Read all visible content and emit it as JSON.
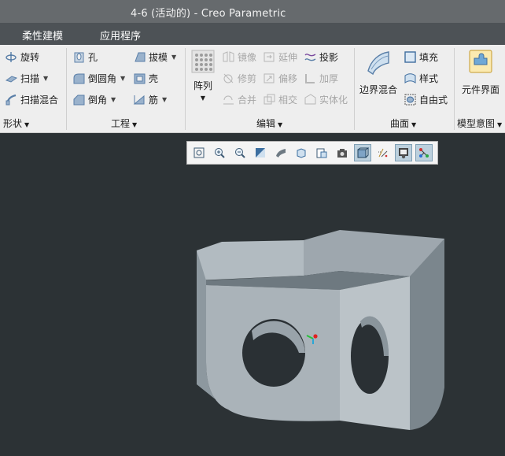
{
  "window": {
    "title": "4-6 (活动的) - Creo Parametric"
  },
  "menu": {
    "items": [
      "柔性建模",
      "应用程序"
    ]
  },
  "ribbon": {
    "groups": {
      "shape": {
        "label": "形状",
        "buttons": [
          "旋转",
          "扫描",
          "扫描混合"
        ]
      },
      "engineering": {
        "label": "工程",
        "buttons": [
          "孔",
          "拔模",
          "倒圆角",
          "壳",
          "倒角",
          "筋"
        ]
      },
      "edit": {
        "label": "编辑",
        "pattern": "阵列",
        "buttons": [
          "镜像",
          "延伸",
          "投影",
          "修剪",
          "偏移",
          "加厚",
          "合并",
          "相交",
          "实体化"
        ]
      },
      "surfaces": {
        "label": "曲面",
        "boundary_blend": "边界混合",
        "buttons": [
          "填充",
          "样式",
          "自由式"
        ]
      },
      "model_intent": {
        "label": "模型意图",
        "component_interface": "元件界面"
      }
    },
    "disabled": [
      "镜像",
      "延伸",
      "修剪",
      "偏移",
      "加厚",
      "合并",
      "相交",
      "实体化"
    ]
  },
  "view_toolbar": {
    "icons": [
      "refit-icon",
      "zoom-in-icon",
      "zoom-out-icon",
      "repaint-icon",
      "display-style-icon",
      "saved-views-icon",
      "view-manager-icon",
      "perspective-icon",
      "shaded-with-edges-icon",
      "datum-display-icon",
      "spin-center-icon",
      "annotation-display-icon"
    ],
    "active": [
      "shaded-with-edges-icon",
      "spin-center-icon",
      "annotation-display-icon"
    ]
  },
  "colors": {
    "titlebar": "#666a6d",
    "menubar": "#4d5256",
    "ribbon": "#eeeeee",
    "viewport": "#2c3235",
    "model_light": "#b6bec4",
    "model_mid": "#9aa4ab",
    "model_dark": "#7d8890"
  }
}
